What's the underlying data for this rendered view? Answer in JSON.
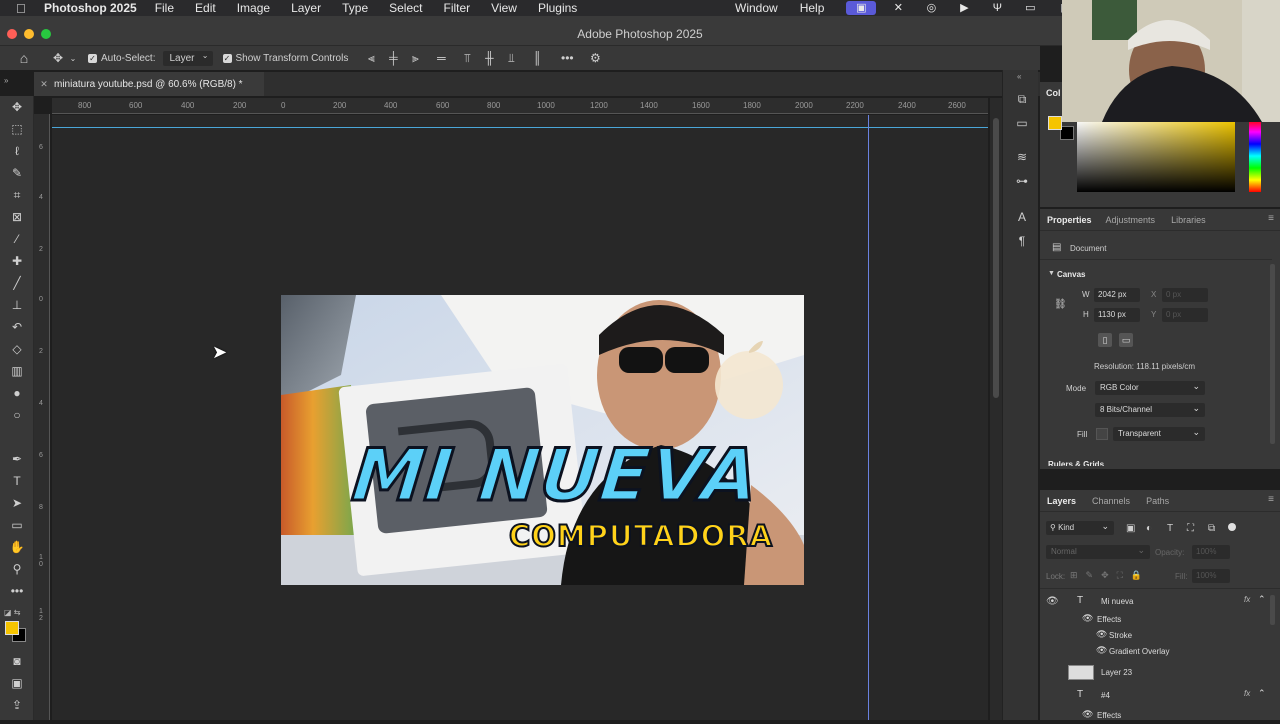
{
  "menubar": {
    "app_name": "Photoshop 2025",
    "items": [
      "File",
      "Edit",
      "Image",
      "Layer",
      "Type",
      "Select",
      "Filter",
      "View",
      "Plugins"
    ],
    "right_items": [
      "Window",
      "Help"
    ]
  },
  "window": {
    "title": "Adobe Photoshop 2025"
  },
  "options": {
    "auto_select_label": "Auto-Select:",
    "auto_select_value": "Layer",
    "show_transform_label": "Show Transform Controls"
  },
  "document": {
    "tab_label": "miniatura youtube.psd @ 60.6% (RGB/8) *"
  },
  "ruler": {
    "h_ticks": [
      "800",
      "600",
      "400",
      "200",
      "0",
      "200",
      "400",
      "600",
      "800",
      "1000",
      "1200",
      "1400",
      "1600",
      "1800",
      "2000",
      "2200",
      "2400",
      "2600"
    ],
    "v_ticks": [
      "6",
      "4",
      "2",
      "0",
      "2",
      "4",
      "6",
      "8",
      "1 0",
      "1 2"
    ]
  },
  "thumbnail": {
    "title_line1": "MI NUEVA",
    "title_line2": "COMPUTADORA"
  },
  "color_panel": {
    "title_fragment": "Col"
  },
  "properties": {
    "tabs": [
      "Properties",
      "Adjustments",
      "Libraries"
    ],
    "doc_label": "Document",
    "section": "Canvas",
    "w_label": "W",
    "w_value": "2042 px",
    "h_label": "H",
    "h_value": "1130 px",
    "x_label": "X",
    "x_placeholder": "0 px",
    "y_label": "Y",
    "y_placeholder": "0 px",
    "resolution": "Resolution: 118.11 pixels/cm",
    "mode_label": "Mode",
    "mode_value": "RGB Color",
    "bits_value": "8 Bits/Channel",
    "fill_label": "Fill",
    "fill_value": "Transparent",
    "next_section": "Rulers & Grids"
  },
  "layers_panel": {
    "tabs": [
      "Layers",
      "Channels",
      "Paths"
    ],
    "filter_kind": "Kind",
    "blend_mode": "Normal",
    "opacity_label": "Opacity:",
    "opacity_value": "100%",
    "lock_label": "Lock:",
    "fill_label": "Fill:",
    "fill_value": "100%",
    "rows": [
      {
        "name": "Mi nueva",
        "type": "text"
      },
      {
        "name": "Effects",
        "type": "effects"
      },
      {
        "name": "Stroke",
        "type": "effect"
      },
      {
        "name": "Gradient Overlay",
        "type": "effect"
      },
      {
        "name": "Layer 23",
        "type": "pixel"
      },
      {
        "name": "#4",
        "type": "text"
      },
      {
        "name": "Effects",
        "type": "effects"
      }
    ]
  },
  "colors": {
    "foreground": "#f5c400",
    "background": "#000000",
    "guide": "#4aa6d8",
    "accent_text_yellow": "#ffd21a"
  },
  "icons": {
    "tools": [
      "move-icon",
      "marquee-icon",
      "lasso-icon",
      "quick-select-icon",
      "crop-icon",
      "frame-icon",
      "eyedropper-icon",
      "spot-heal-icon",
      "brush-icon",
      "stamp-icon",
      "history-brush-icon",
      "eraser-icon",
      "gradient-icon",
      "blur-icon",
      "dodge-icon",
      "pen-icon",
      "type-icon",
      "path-select-icon",
      "rectangle-icon",
      "hand-icon",
      "zoom-icon",
      "more-tools-icon"
    ]
  }
}
